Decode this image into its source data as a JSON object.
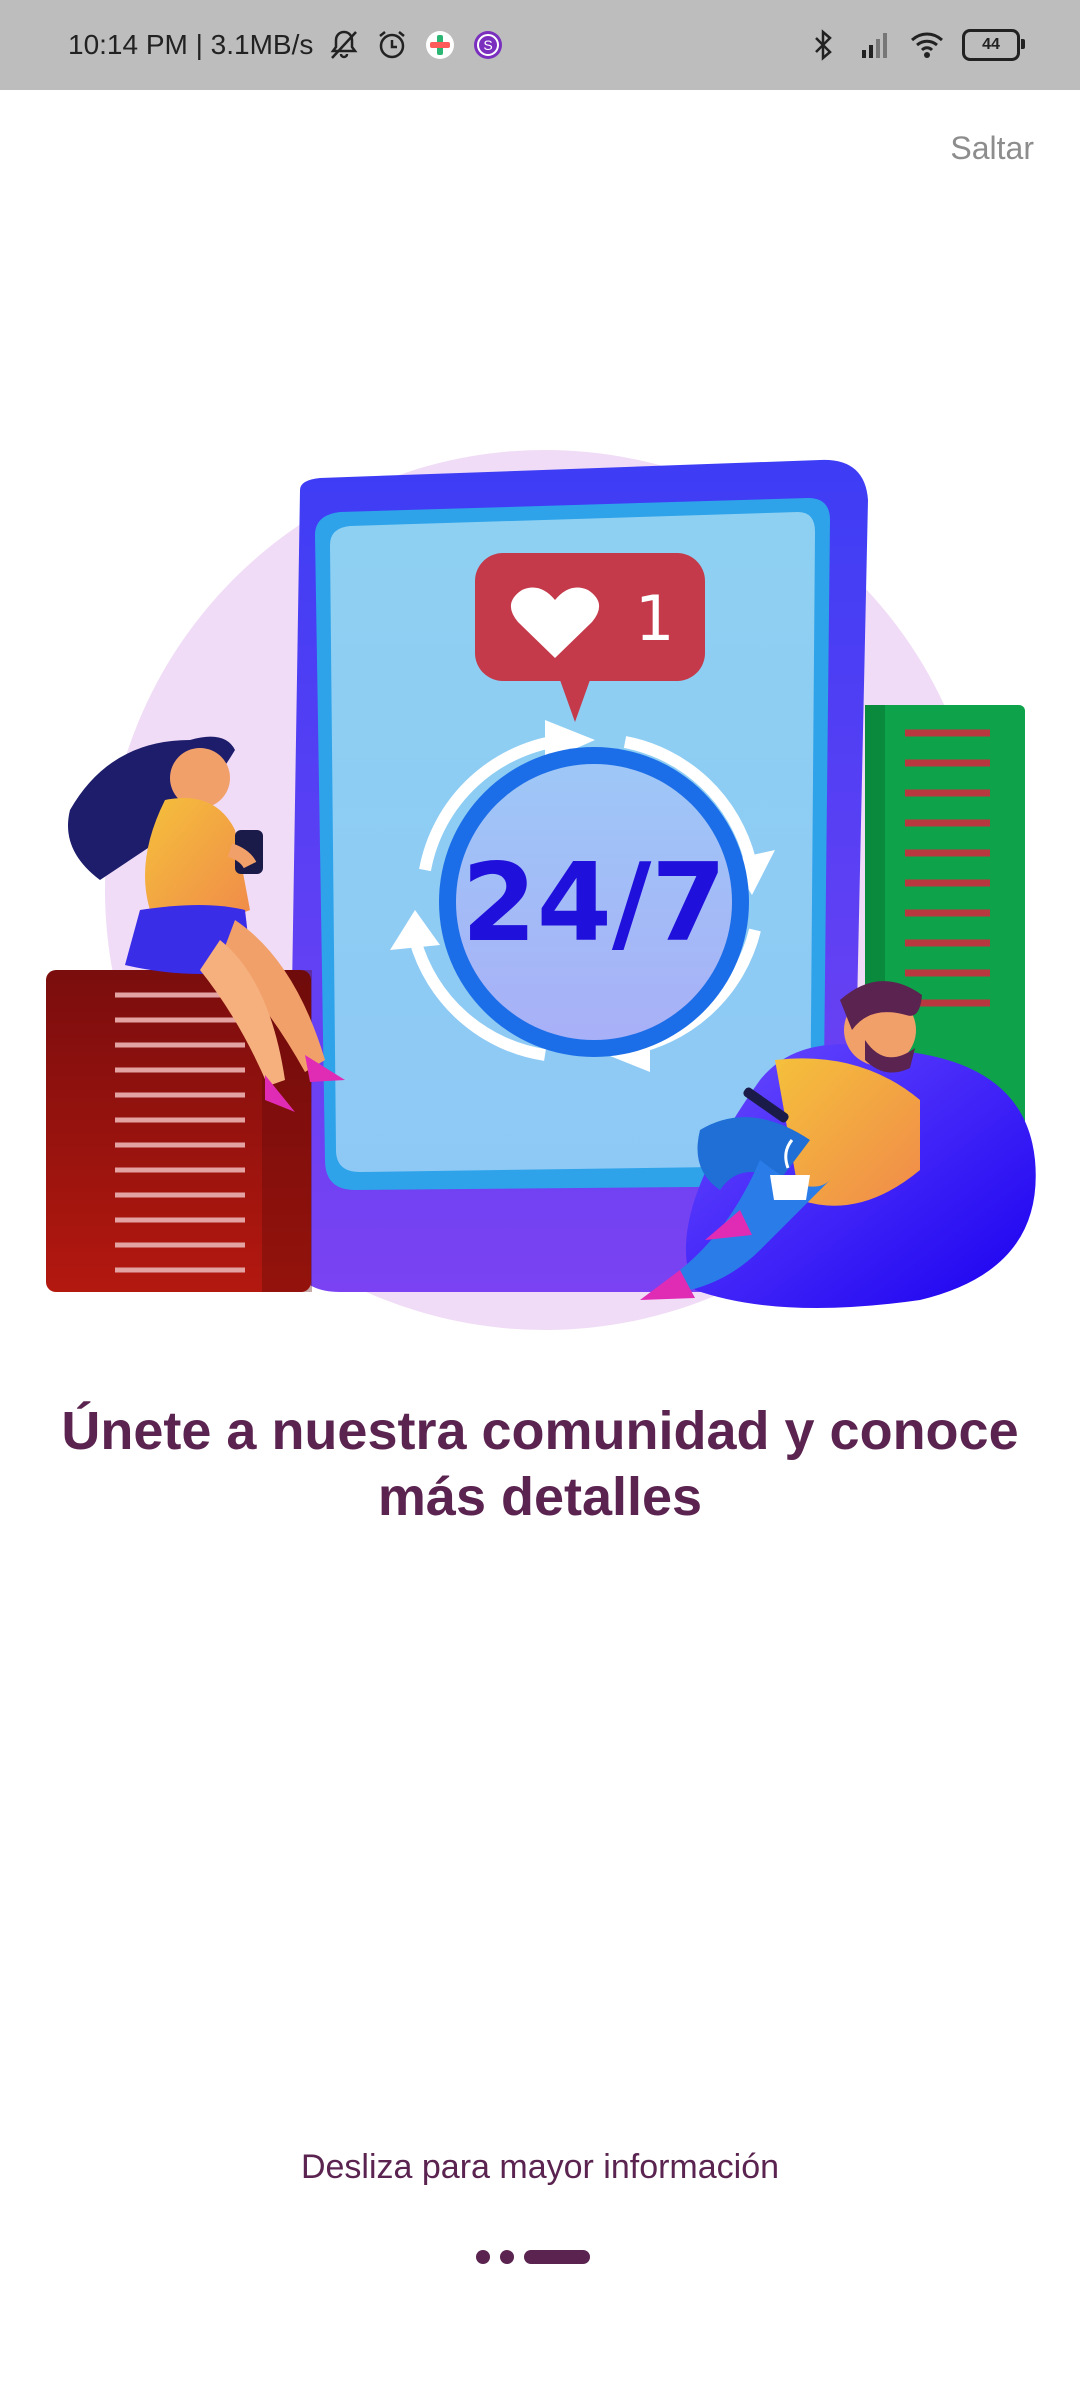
{
  "status_bar": {
    "time_speed": "10:14 PM | 3.1MB/s",
    "battery": "44"
  },
  "skip_label": "Saltar",
  "illustration": {
    "like_count": "1",
    "availability_text": "24/7"
  },
  "headline": "Únete a nuestra comunidad y conoce más detalles",
  "swipe_hint": "Desliza para mayor información",
  "pagination": {
    "total": 3,
    "active_index": 2
  },
  "colors": {
    "primary": "#5a2350",
    "status_bar_bg": "#bdbdbd",
    "skip_text": "#8d8d8d"
  }
}
